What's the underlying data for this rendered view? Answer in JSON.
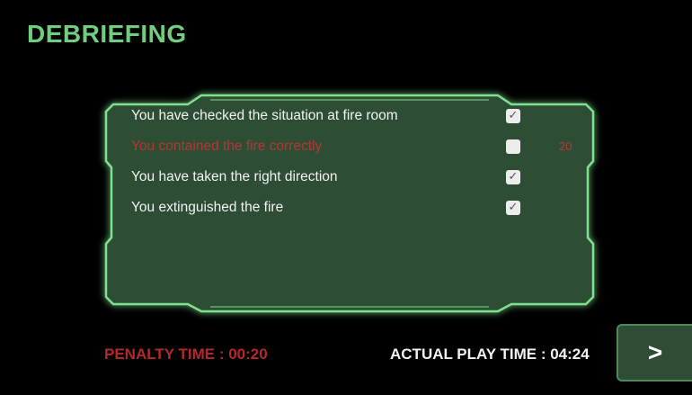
{
  "screen": {
    "title": "DEBRIEFING"
  },
  "checklist": [
    {
      "label": "You have checked the situation at fire room",
      "checked": true,
      "penalty": ""
    },
    {
      "label": "You contained the fire correctly",
      "checked": false,
      "penalty": "20"
    },
    {
      "label": "You have taken the right direction",
      "checked": true,
      "penalty": ""
    },
    {
      "label": "You extinguished the fire",
      "checked": true,
      "penalty": ""
    }
  ],
  "footer": {
    "penalty_time": "PENALTY TIME : 00:20",
    "actual_play_time": "ACTUAL PLAY TIME : 04:24"
  },
  "next_button": {
    "label": ">"
  },
  "colors": {
    "title_green": "#6fcf7f",
    "panel_fill": "#2e4d34",
    "panel_border": "#7fe08f",
    "failed_red": "#b8352f",
    "penalty_red": "#b3282a"
  },
  "icons": {
    "checkbox_checked": "check-mark",
    "checkbox_unchecked": "empty-box"
  }
}
